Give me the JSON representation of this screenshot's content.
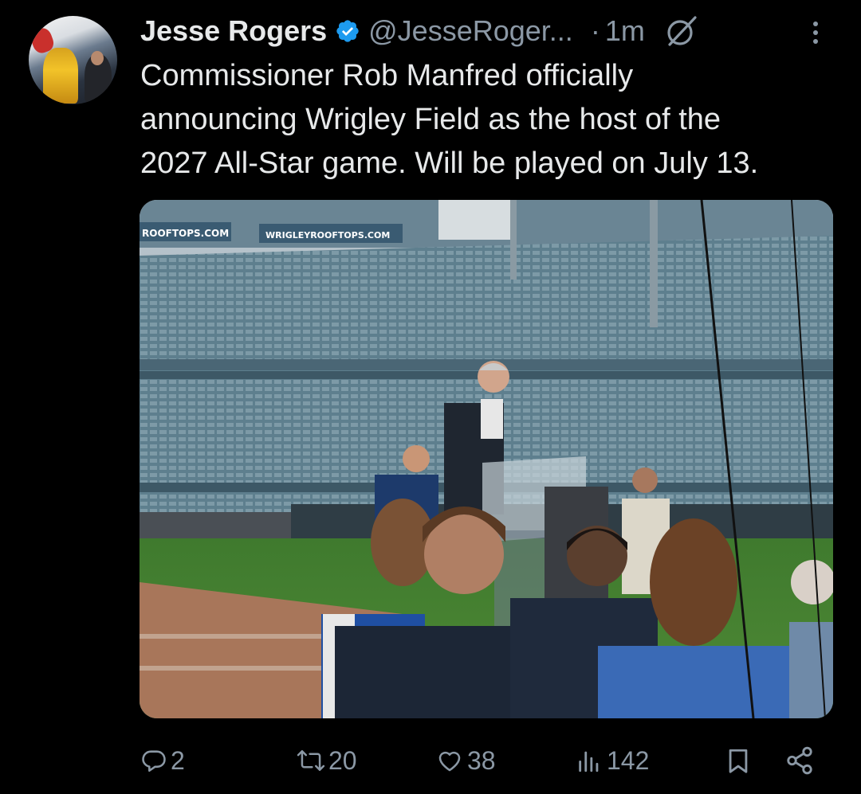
{
  "tweet": {
    "author": {
      "display_name": "Jesse Rogers",
      "handle": "@JesseRoger...",
      "verified": true,
      "avatar_icon": "profile-avatar"
    },
    "separator": "·",
    "time": "1m",
    "text": "Commissioner Rob Manfred officially\nannouncing Wrigley Field as the host of the\n2027 All-Star game. Will be played on July 13.",
    "media": {
      "type": "photo",
      "signs": [
        "ROOFTOPS.COM",
        "WRIGLEYROOFTOPS.COM"
      ]
    },
    "stats": {
      "replies": "2",
      "reposts": "20",
      "likes": "38",
      "views": "142"
    }
  },
  "icons": {
    "verified": "verified-badge-icon",
    "grok": "grok-icon",
    "more": "more-options-icon",
    "reply": "reply-icon",
    "repost": "repost-icon",
    "like": "like-icon",
    "views": "views-icon",
    "bookmark": "bookmark-icon",
    "share": "share-icon"
  },
  "colors": {
    "background": "#000000",
    "text_primary": "#e7e9ea",
    "text_secondary": "#8b98a5",
    "verified_blue": "#1d9bf0"
  }
}
